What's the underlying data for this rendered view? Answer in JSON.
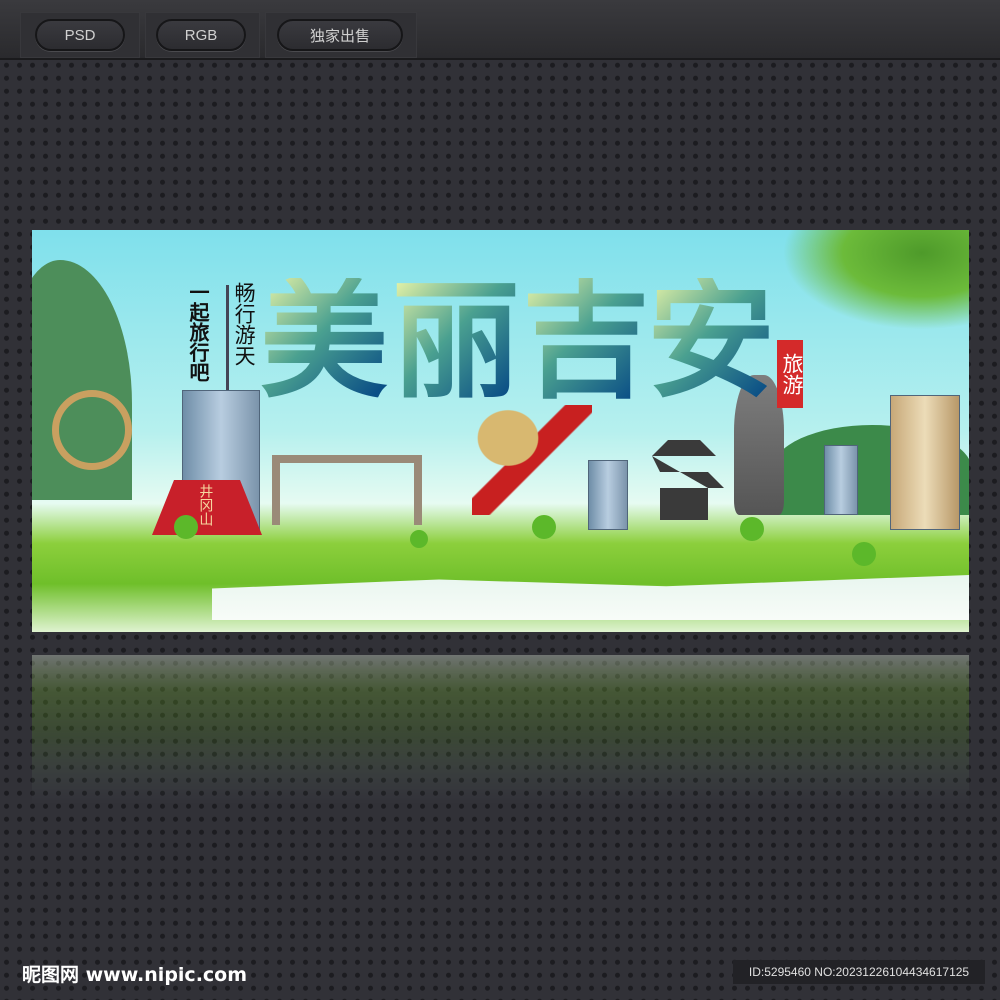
{
  "toolbar": {
    "buttons": [
      {
        "label": "PSD"
      },
      {
        "label": "RGB"
      },
      {
        "label": "独家出售"
      }
    ]
  },
  "banner": {
    "title_chars": [
      "美",
      "丽",
      "吉",
      "安"
    ],
    "slogan_left": "一起旅行吧",
    "slogan_right": "畅行游天",
    "seal": "旅游",
    "monument_text": "井冈山"
  },
  "footer": {
    "logo": "昵图网 www.nipic.com",
    "id_text": "ID:5295460 NO:20231226104434617125"
  },
  "colors": {
    "seal_red": "#d42a2a",
    "title_dark": "#0b4f86",
    "title_light": "#eef7a8",
    "grass": "#6fbf2a"
  }
}
